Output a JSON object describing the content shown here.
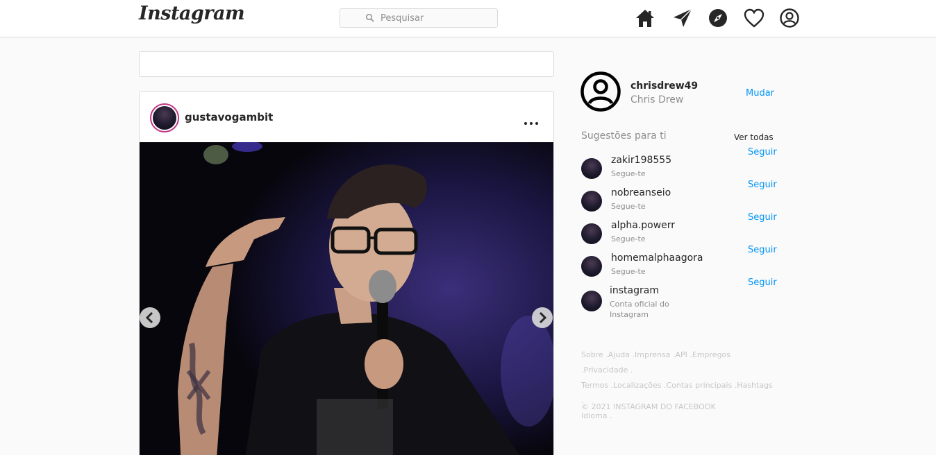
{
  "header": {
    "logo": "Instagram",
    "search_placeholder": "Pesquisar",
    "icons": [
      "home-icon",
      "direct-icon",
      "explore-icon",
      "activity-icon",
      "profile-icon"
    ]
  },
  "post": {
    "username": "gustavogambit",
    "avatar_ring_color": "#c13584"
  },
  "profile": {
    "username": "chrisdrew49",
    "name": "Chris Drew",
    "switch_label": "Mudar"
  },
  "suggestions": {
    "title": "Sugestões para ti",
    "see_all": "Ver todas",
    "follow_label": "Seguir",
    "items": [
      {
        "username": "zakir198555",
        "sub": "Segue-te"
      },
      {
        "username": "nobreanseio",
        "sub": "Segue-te"
      },
      {
        "username": "alpha.powerr",
        "sub": "Segue-te"
      },
      {
        "username": "homemalphaagora",
        "sub": "Segue-te"
      },
      {
        "username": "instagram",
        "sub": "Conta oficial do Instagram"
      }
    ]
  },
  "footer": {
    "links": [
      "Sobre",
      "Ajuda",
      "Imprensa",
      "API",
      "Empregos",
      "Privacidade",
      "Termos",
      "Localizações",
      "Contas principais",
      "Hashtags",
      "Idioma"
    ],
    "copyright": "© 2021 INSTAGRAM DO FACEBOOK"
  },
  "colors": {
    "link": "#0095f6",
    "muted": "#8e8e8e",
    "text": "#262626",
    "border": "#dbdbdb"
  }
}
